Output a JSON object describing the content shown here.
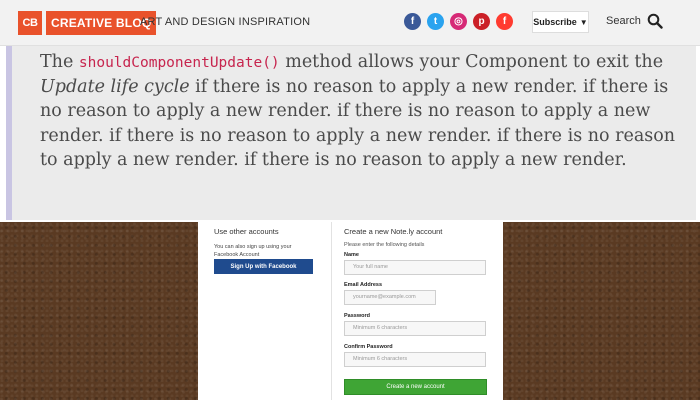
{
  "header": {
    "logo_badge": "CB",
    "logo_word": "CREATIVE BLOQ",
    "tagline": "ART AND DESIGN INSPIRATION",
    "socials": [
      {
        "icon": "facebook-icon",
        "glyph": "f",
        "color": "#3b5998"
      },
      {
        "icon": "twitter-icon",
        "glyph": "t",
        "color": "#2aa3ef"
      },
      {
        "icon": "instagram-icon",
        "glyph": "◎",
        "color": "#d62976"
      },
      {
        "icon": "pinterest-icon",
        "glyph": "p",
        "color": "#cb2027"
      },
      {
        "icon": "flipboard-icon",
        "glyph": "f",
        "color": "#ff3b30"
      }
    ],
    "subscribe_label": "Subscribe",
    "subscribe_caret": "▼",
    "search_label": "Search"
  },
  "article": {
    "part1": "The ",
    "code": "shouldComponentUpdate()",
    "part2": " method allows your Component to exit the ",
    "emphasis": "Update life cycle",
    "part3": " if there is no reason to apply a new render. if there is no reason to apply a new render. if there is no reason to apply a new render. if there is no reason to apply a new render. if there is no reason to apply a new render. if there is no reason to apply a new render."
  },
  "signup": {
    "left_title": "Use other accounts",
    "left_desc": "You can also sign up using your Facebook Account",
    "facebook_button": "Sign Up with Facebook",
    "right_title": "Create a new Note.ly account",
    "right_subtitle": "Please enter the following details",
    "name_label": "Name",
    "name_placeholder": "Your full name",
    "email_label": "Email Address",
    "email_placeholder": "yourname@example.com",
    "password_label": "Password",
    "password_placeholder": "Minimum 6 characters",
    "confirm_label": "Confirm Password",
    "confirm_placeholder": "Minimum 6 characters",
    "create_button": "Create a new account"
  },
  "colors": {
    "brand": "#e9522b",
    "quote_border": "#c9c5e3",
    "code_text": "#c7254e",
    "facebook_button": "#1f4b8e",
    "create_button": "#3fa535",
    "wood_background": "#5a3a22"
  }
}
